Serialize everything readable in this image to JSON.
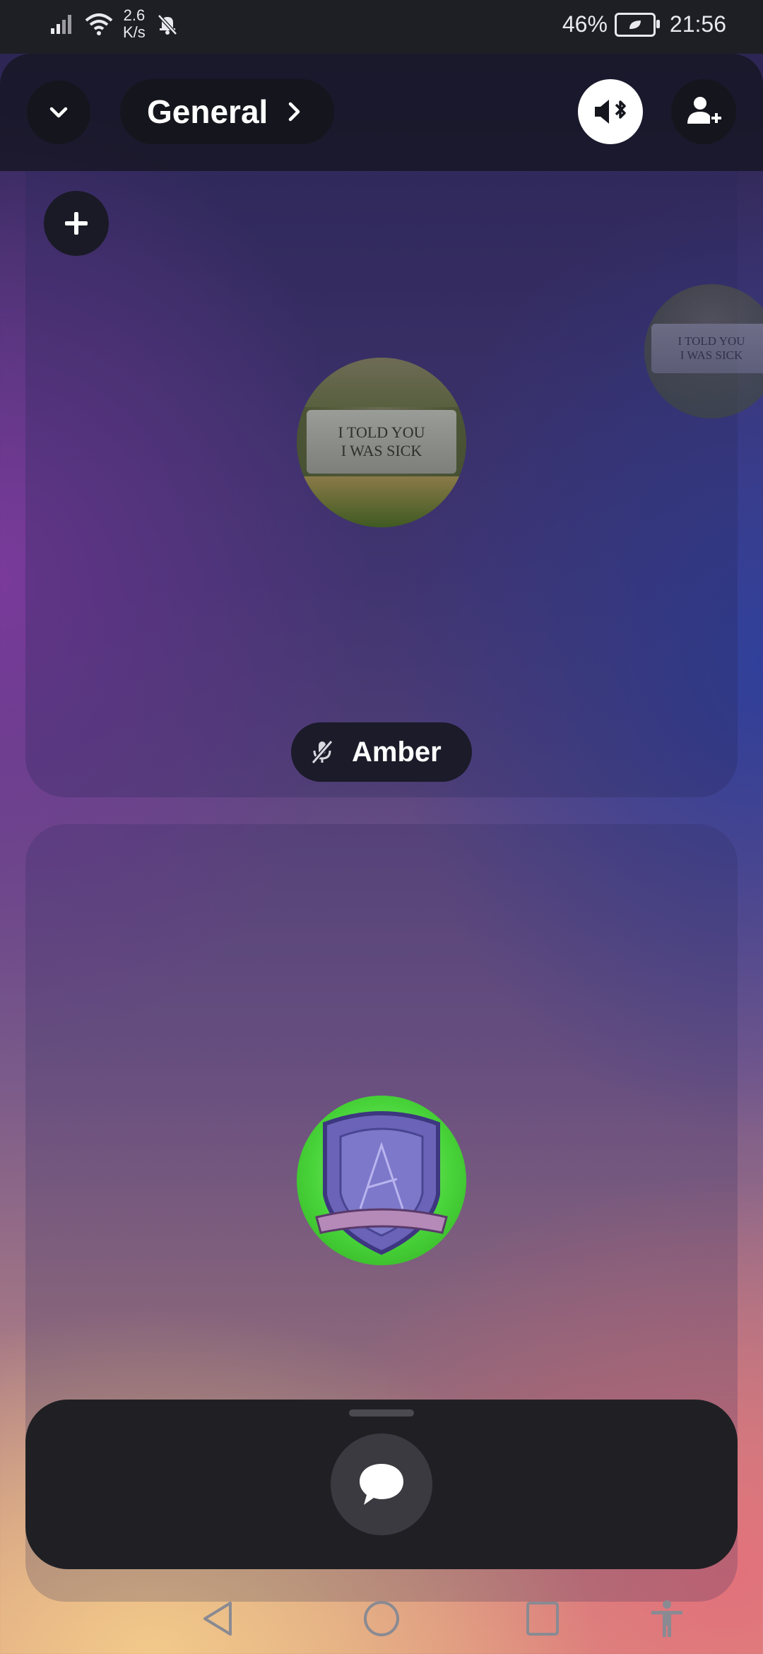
{
  "status_bar": {
    "net_speed_value": "2.6",
    "net_speed_unit": "K/s",
    "battery_percent": "46%",
    "time": "21:56",
    "icons": [
      "signal-icon",
      "wifi-icon",
      "bell-off-icon",
      "battery-saver-icon"
    ]
  },
  "header": {
    "channel_name": "General",
    "collapse_icon": "chevron-down-icon",
    "channel_chevron_icon": "chevron-right-icon",
    "audio_output_icon": "bluetooth-speaker-icon",
    "invite_icon": "add-user-icon"
  },
  "participants": [
    {
      "name": "Amber",
      "muted": true,
      "avatar_text_line1": "I TOLD YOU",
      "avatar_text_line2": "I WAS SICK"
    }
  ],
  "bottom_sheet": {
    "chat_icon": "chat-bubble-icon"
  },
  "nav_bar": {
    "icons": [
      "back-icon",
      "home-icon",
      "recents-icon",
      "accessibility-icon"
    ]
  },
  "colors": {
    "status_bar_bg": "#1e1f24",
    "pill_bg": "#15151d",
    "sheet_bg": "#202024",
    "shield_green": "#49d43a",
    "shield_purple": "#6a63b8"
  }
}
